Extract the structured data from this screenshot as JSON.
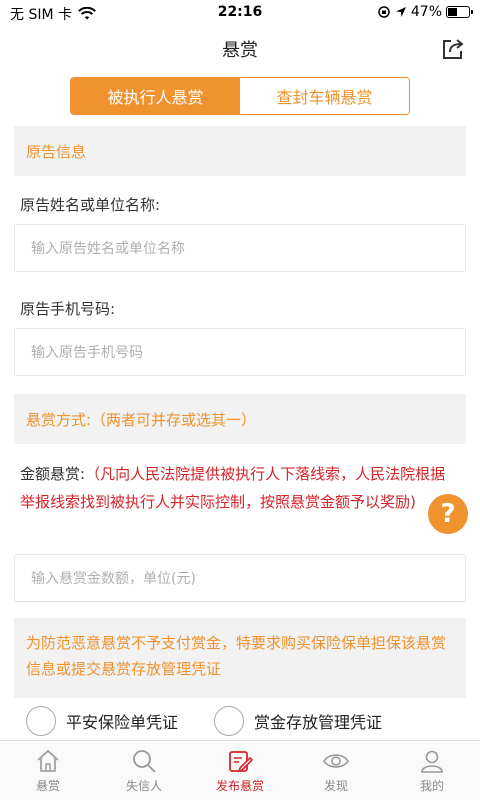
{
  "status_bar": {
    "carrier": "无 SIM 卡",
    "time": "22:16",
    "battery": "47%",
    "battery_level": 0.47
  },
  "nav": {
    "title": "悬赏",
    "share_icon": "share-icon"
  },
  "segment": {
    "tab1": "被执行人悬赏",
    "tab2": "查封车辆悬赏",
    "active": 0
  },
  "plaintiff": {
    "section_title": "原告信息",
    "name_label": "原告姓名或单位名称:",
    "name_placeholder": "输入原告姓名或单位名称",
    "phone_label": "原告手机号码:",
    "phone_placeholder": "输入原告手机号码"
  },
  "reward": {
    "section_title": "悬赏方式:（两者可并存或选其一）",
    "amount_label": "金额悬赏:",
    "amount_note": "（凡向人民法院提供被执行人下落线索，人民法院根据举报线索找到被执行人并实际控制，按照悬赏金额予以奖励)",
    "amount_placeholder": "输入悬赏金数额，单位(元)",
    "warning": "为防范恶意悬赏不予支付赏金，特要求购买保险保单担保该悬赏信息或提交悬赏存放管理凭证",
    "option1": "平安保险单凭证",
    "option2": "赏金存放管理凭证"
  },
  "tabbar": {
    "items": [
      {
        "label": "悬赏",
        "icon": "home-icon"
      },
      {
        "label": "失信人",
        "icon": "search-icon"
      },
      {
        "label": "发布悬赏",
        "icon": "edit-icon"
      },
      {
        "label": "发现",
        "icon": "eye-icon"
      },
      {
        "label": "我的",
        "icon": "user-icon"
      }
    ],
    "active_index": 2
  },
  "colors": {
    "accent": "#f0922e",
    "red": "#d6232a",
    "section_bg": "#f2f2f2"
  }
}
